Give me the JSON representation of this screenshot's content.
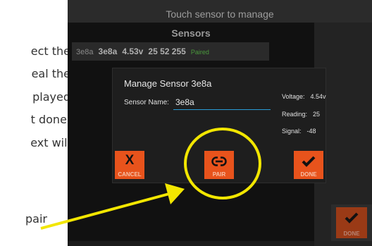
{
  "doc_text": {
    "lines": [
      "ect the",
      "eal the",
      "played",
      "t done.",
      "ext will"
    ],
    "annotation": "pair"
  },
  "app": {
    "header": "Touch sensor to manage",
    "sensors_title": "Sensors",
    "sensor_row": {
      "id_small": "3e8a",
      "name": "3e8a",
      "voltage": "4.53v",
      "values": "25 52 255",
      "status": "Paired"
    }
  },
  "dialog": {
    "title": "Manage Sensor 3e8a",
    "name_label": "Sensor Name:",
    "name_value": "3e8a",
    "voltage_label": "Voltage:",
    "voltage_value": "4.54v",
    "reading_label": "Reading:",
    "reading_value": "25",
    "signal_label": "Signal:",
    "signal_value": "-48",
    "cancel_label": "CANCEL",
    "pair_label": "PAIR",
    "done_label": "DONE"
  },
  "outer_done_label": "DONE",
  "colors": {
    "accent_orange": "#e8531c",
    "input_underline": "#2a9bd6",
    "highlight_yellow": "#f2e600",
    "paired_green": "#4a9a3c"
  },
  "icons": {
    "cancel": "x-icon",
    "pair": "link-icon",
    "done": "checkmark-icon"
  }
}
